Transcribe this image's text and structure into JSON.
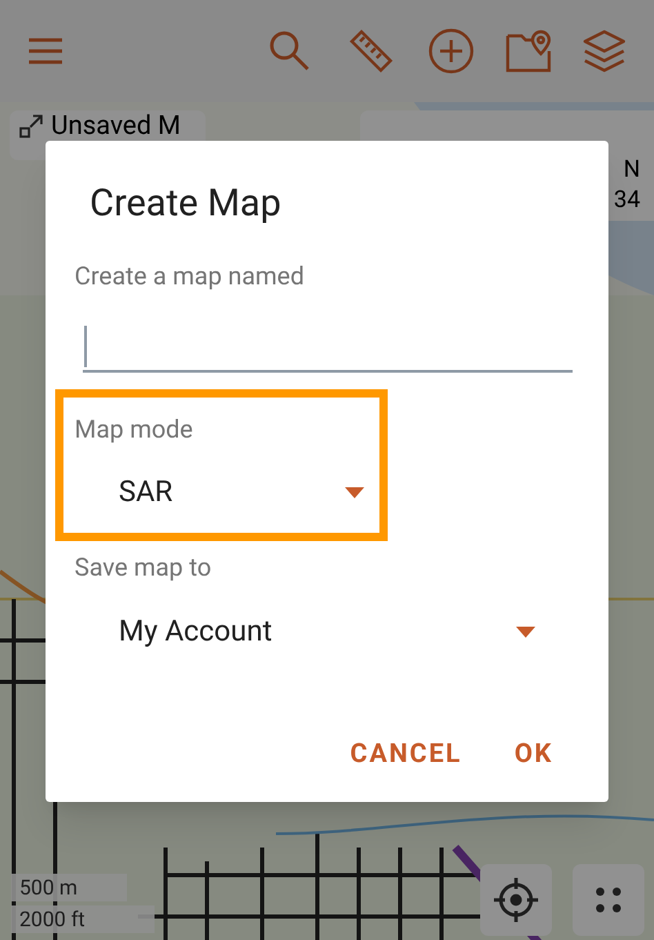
{
  "map_chip": {
    "label": "Unsaved M"
  },
  "coordinates": {
    "lines": [
      "N",
      "34"
    ]
  },
  "dialog": {
    "title": "Create Map",
    "fields": [
      {
        "kind": "text",
        "label": "Create a map named",
        "focused": true,
        "highlighted": false
      },
      {
        "kind": "select",
        "label": "Map mode",
        "value": "SAR",
        "highlighted": true
      },
      {
        "kind": "select",
        "label": "Save map to",
        "value": "My Account",
        "highlighted": false
      }
    ],
    "buttons": [
      "CANCEL",
      "OK"
    ]
  },
  "scale": [
    "500 m",
    "2000 ft"
  ]
}
